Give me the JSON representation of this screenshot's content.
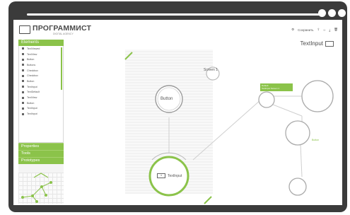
{
  "header": {
    "app_name": "ПРОГРАММИСТ",
    "app_subtitle": "DIGITAL AGENCY",
    "toolbar": {
      "save_label": "Сохранить"
    }
  },
  "sidebar": {
    "panel_title": "Elements",
    "items": [
      {
        "label": "TextViewed"
      },
      {
        "label": "TextView"
      },
      {
        "label": "Button"
      },
      {
        "label": "Buttons"
      },
      {
        "label": "Checkbox"
      },
      {
        "label": "Checkbox"
      },
      {
        "label": "Button"
      },
      {
        "label": "TextInput"
      },
      {
        "label": "TextDefault"
      },
      {
        "label": "TextView"
      },
      {
        "label": "Button"
      },
      {
        "label": "TextInput"
      },
      {
        "label": "TextInput"
      }
    ],
    "sections": [
      "Properties",
      "Tools",
      "Prototypes"
    ]
  },
  "canvas": {
    "screen_label": "Screen 1",
    "button_node_label": "Button",
    "textinput_node_label": "TextInput",
    "selected_element_title": "TextInput",
    "tooltip_line1": "Default",
    "tooltip_line2": "TextInput Screen 1",
    "right_node_label": "Button"
  },
  "colors": {
    "accent": "#8bc34a",
    "frame": "#3b3b3b",
    "text": "#4a4a4a"
  }
}
